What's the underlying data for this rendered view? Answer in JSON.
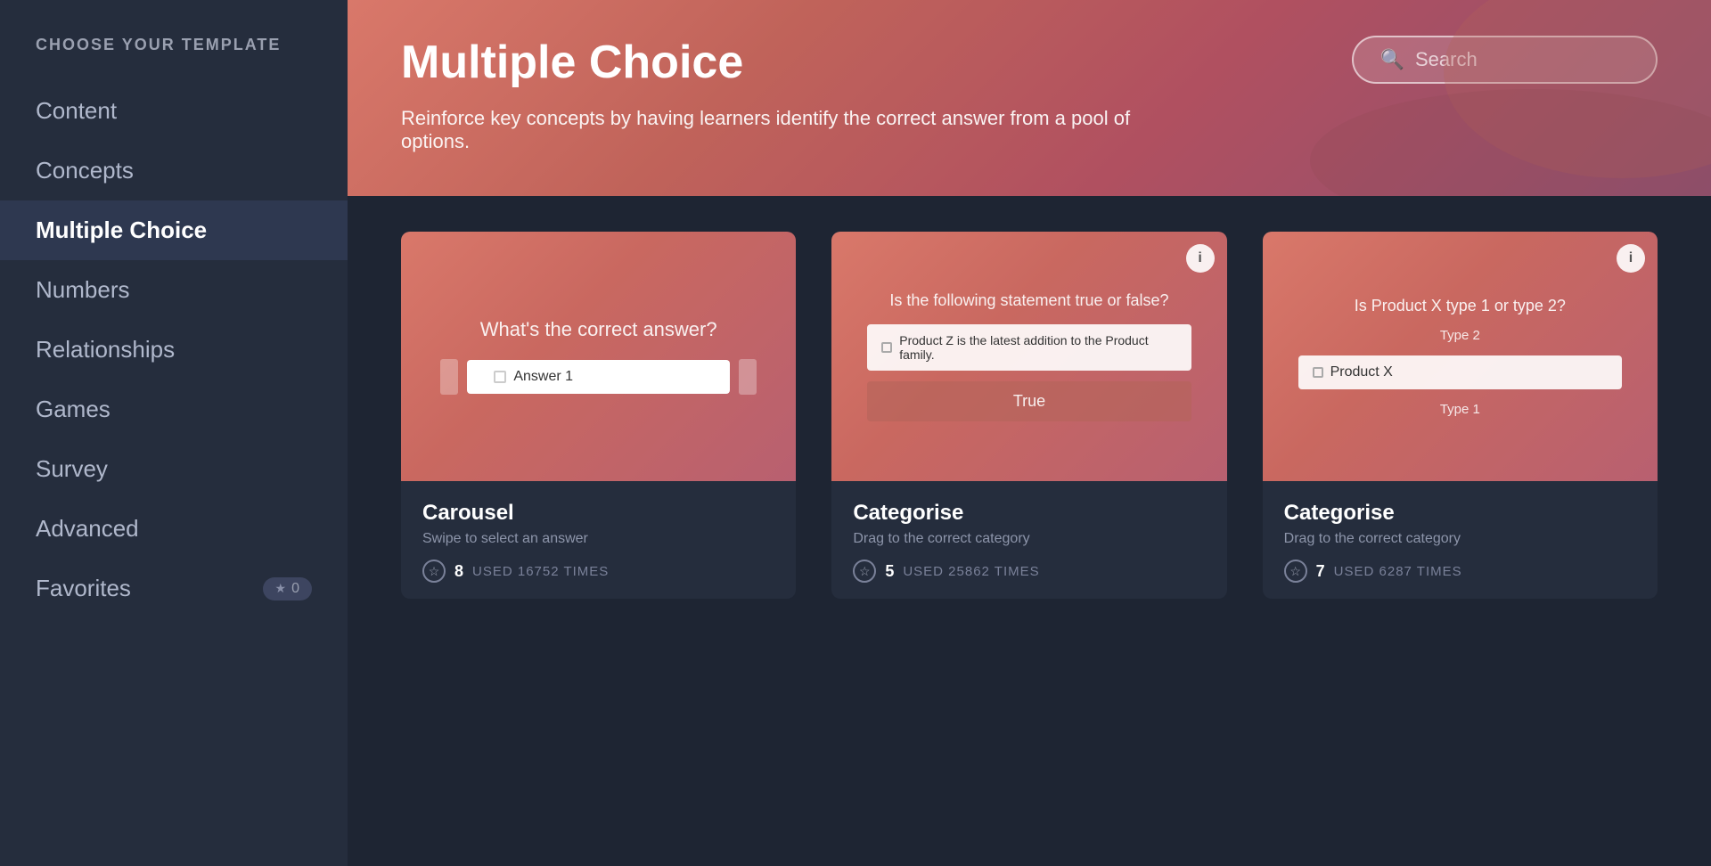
{
  "sidebar": {
    "header": "CHOOSE YOUR TEMPLATE",
    "items": [
      {
        "id": "content",
        "label": "Content",
        "active": false
      },
      {
        "id": "concepts",
        "label": "Concepts",
        "active": false
      },
      {
        "id": "multiple-choice",
        "label": "Multiple Choice",
        "active": true
      },
      {
        "id": "numbers",
        "label": "Numbers",
        "active": false
      },
      {
        "id": "relationships",
        "label": "Relationships",
        "active": false
      },
      {
        "id": "games",
        "label": "Games",
        "active": false
      },
      {
        "id": "survey",
        "label": "Survey",
        "active": false
      },
      {
        "id": "advanced",
        "label": "Advanced",
        "active": false
      },
      {
        "id": "favorites",
        "label": "Favorites",
        "active": false
      }
    ],
    "favorites_count": "0"
  },
  "header": {
    "title": "Multiple Choice",
    "description": "Reinforce key concepts by having learners identify the correct answer from a pool of options.",
    "search_placeholder": "Search"
  },
  "cards": [
    {
      "id": "carousel",
      "title": "Carousel",
      "subtitle": "Swipe to select an answer",
      "rating": "8",
      "used_times": "USED 16752 TIMES",
      "preview_type": "carousel",
      "question": "What's the correct answer?",
      "answer": "Answer 1"
    },
    {
      "id": "categorise-1",
      "title": "Categorise",
      "subtitle": "Drag to the correct category",
      "rating": "5",
      "used_times": "USED 25862 TIMES",
      "preview_type": "categorise1",
      "question": "Is the following statement true or false?",
      "statement": "Product Z is the latest addition to the Product family.",
      "true_label": "True"
    },
    {
      "id": "categorise-2",
      "title": "Categorise",
      "subtitle": "Drag to the correct category",
      "rating": "7",
      "used_times": "USED 6287 TIMES",
      "preview_type": "categorise2",
      "question": "Is Product X type 1 or type 2?",
      "type2_label": "Type 2",
      "product_label": "Product X",
      "type1_label": "Type 1"
    }
  ],
  "info_icon": "ℹ",
  "star_icon": "☆",
  "star_filled": "★",
  "search_icon": "🔍"
}
